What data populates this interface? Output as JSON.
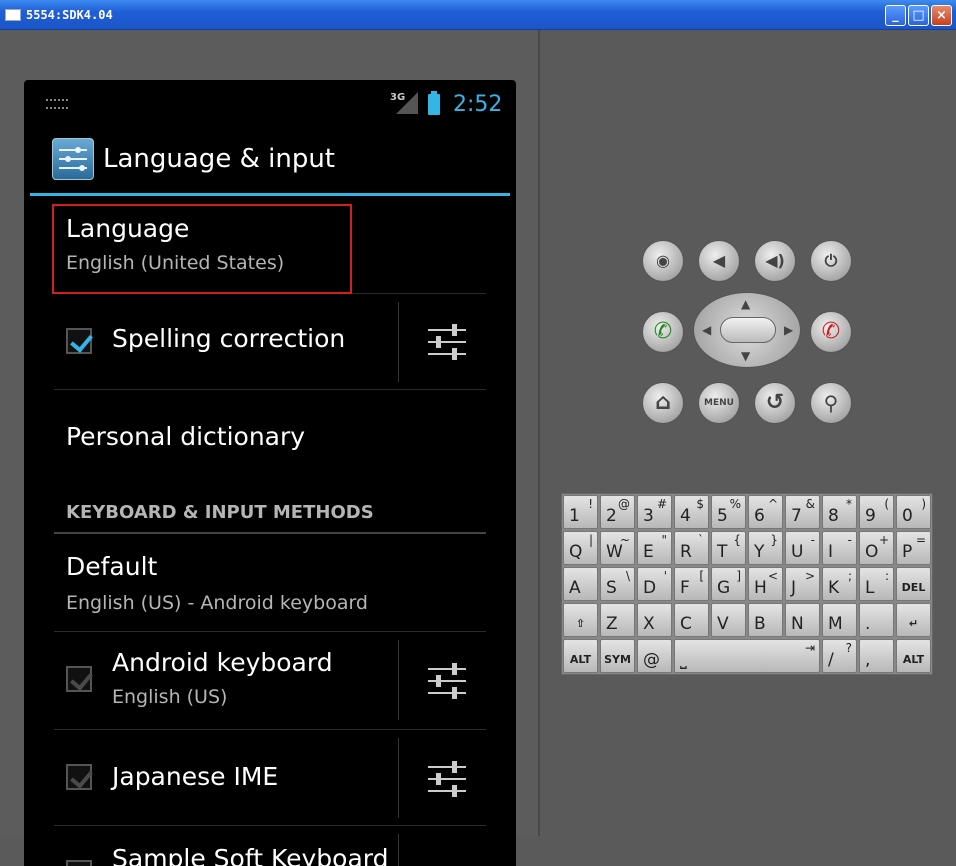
{
  "window": {
    "title": "5554:SDK4.04",
    "min": "_",
    "max": "□",
    "close": "×"
  },
  "status": {
    "network": "3G",
    "time": "2:52"
  },
  "actionbar": {
    "title": "Language & input"
  },
  "items": {
    "language": {
      "title": "Language",
      "summary": "English (United States)"
    },
    "spelling": {
      "title": "Spelling correction"
    },
    "dictionary": {
      "title": "Personal dictionary"
    },
    "section": "KEYBOARD & INPUT METHODS",
    "default": {
      "title": "Default",
      "summary": "English (US) - Android keyboard"
    },
    "android_kb": {
      "title": "Android keyboard",
      "summary": "English (US)"
    },
    "japanese": {
      "title": "Japanese IME"
    },
    "sample": {
      "title": "Sample Soft Keyboard"
    }
  },
  "emulator": {
    "buttons": {
      "camera": "◉",
      "vol_down": "◀",
      "vol_up": "◀)",
      "power": "⏻",
      "call": "✆",
      "end": "✆",
      "home": "⌂",
      "menu": "MENU",
      "back": "↺",
      "search": "⚲"
    },
    "keyboard": {
      "row1": [
        [
          "1",
          "!"
        ],
        [
          "2",
          "@"
        ],
        [
          "3",
          "#"
        ],
        [
          "4",
          "$"
        ],
        [
          "5",
          "%"
        ],
        [
          "6",
          "^"
        ],
        [
          "7",
          "&"
        ],
        [
          "8",
          "*"
        ],
        [
          "9",
          "("
        ],
        [
          "0",
          ")"
        ]
      ],
      "row2": [
        [
          "Q",
          "|"
        ],
        [
          "W",
          "~"
        ],
        [
          "E",
          "\""
        ],
        [
          "R",
          "`"
        ],
        [
          "T",
          "{"
        ],
        [
          "Y",
          "}"
        ],
        [
          "U",
          "-"
        ],
        [
          "I",
          "-"
        ],
        [
          "O",
          "+"
        ],
        [
          "P",
          "="
        ]
      ],
      "row3": [
        [
          "A",
          ""
        ],
        [
          "S",
          "\\"
        ],
        [
          "D",
          "'"
        ],
        [
          "F",
          "["
        ],
        [
          "G",
          "]"
        ],
        [
          "H",
          "<"
        ],
        [
          "J",
          ">"
        ],
        [
          "K",
          ";"
        ],
        [
          "L",
          ":"
        ]
      ],
      "row4": [
        [
          "Z",
          ""
        ],
        [
          "X",
          ""
        ],
        [
          "C",
          ""
        ],
        [
          "V",
          ""
        ],
        [
          "B",
          ""
        ],
        [
          "N",
          ""
        ],
        [
          "M",
          ""
        ],
        [
          ".",
          ""
        ]
      ],
      "del": "DEL",
      "shift": "⇧",
      "enter": "↵",
      "alt": "ALT",
      "sym": "SYM",
      "at": "@",
      "slash": [
        "/",
        "?"
      ],
      "comma": ",",
      "tab": "⇥",
      "space": "⎵"
    }
  }
}
